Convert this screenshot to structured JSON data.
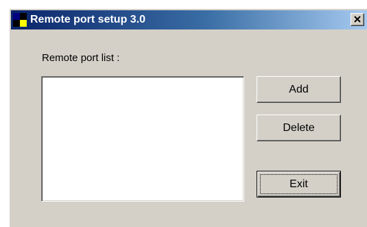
{
  "window": {
    "title": "Remote port setup 3.0",
    "app_icon": "app-icon",
    "close_icon": "close-icon"
  },
  "main": {
    "list_label": "Remote port list :",
    "list_items": []
  },
  "buttons": {
    "add_label": "Add",
    "delete_label": "Delete",
    "exit_label": "Exit"
  },
  "colors": {
    "titlebar_start": "#0a246a",
    "titlebar_end": "#a6caf0",
    "window_face": "#d4d0c8"
  }
}
